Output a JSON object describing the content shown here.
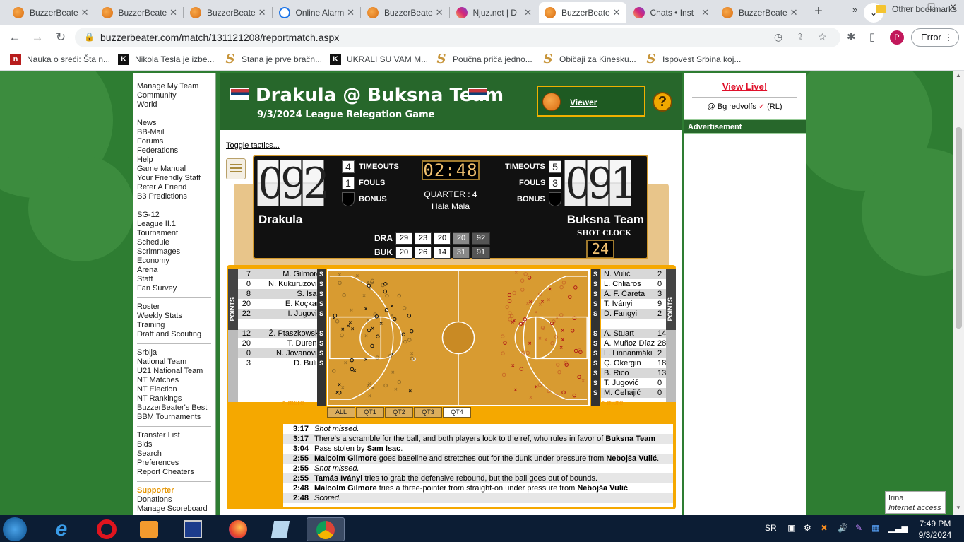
{
  "browser": {
    "tabs": [
      {
        "title": "BuzzerBeater",
        "icon": "basketball-icon",
        "active": false
      },
      {
        "title": "BuzzerBeater",
        "icon": "basketball-icon",
        "active": false
      },
      {
        "title": "BuzzerBeater",
        "icon": "basketball-icon",
        "active": false
      },
      {
        "title": "Online Alarm",
        "icon": "checkmark-icon",
        "active": false
      },
      {
        "title": "BuzzerBeater",
        "icon": "basketball-icon",
        "active": false
      },
      {
        "title": "Njuz.net | D",
        "icon": "instagram-icon",
        "active": false
      },
      {
        "title": "BuzzerBeater",
        "icon": "basketball-icon",
        "active": true
      },
      {
        "title": "Chats • Inst",
        "icon": "instagram-icon",
        "active": false
      },
      {
        "title": "BuzzerBeater",
        "icon": "basketball-icon",
        "active": false
      }
    ],
    "url": "buzzerbeater.com/match/131121208/reportmatch.aspx",
    "profile_initial": "P",
    "error_label": "Error",
    "bookmarks": [
      {
        "label": "Nauka o sreći: Šta n...",
        "icon": "n"
      },
      {
        "label": "Nikola Tesla je izbe...",
        "icon": "K"
      },
      {
        "label": "Stana je prve bračn...",
        "icon": "S"
      },
      {
        "label": "UKRALI SU VAM M...",
        "icon": "K"
      },
      {
        "label": "Poučna priča jedno...",
        "icon": "S"
      },
      {
        "label": "Običaji za Kinesku...",
        "icon": "S"
      },
      {
        "label": "Ispovest Srbina koj...",
        "icon": "S"
      }
    ],
    "bookmarks_more": "»",
    "other_bookmarks": "Other bookmarks"
  },
  "nav": {
    "group1": [
      "Manage My Team",
      "Community",
      "World"
    ],
    "group2": [
      "News",
      "BB-Mail",
      "Forums",
      "Federations",
      "Help",
      "Game Manual",
      "Your Friendly Staff",
      "Refer A Friend",
      "B3 Predictions"
    ],
    "group3": [
      "SG-12",
      "League II.1",
      "Tournament",
      "Schedule",
      "Scrimmages",
      "Economy",
      "Arena",
      "Staff",
      "Fan Survey"
    ],
    "group4": [
      "Roster",
      "Weekly Stats",
      "Training",
      "Draft and Scouting"
    ],
    "group5": [
      "Srbija",
      "National Team",
      "U21 National Team",
      "NT Matches",
      "NT Election",
      "NT Rankings",
      "BuzzerBeater's Best",
      "BBM Tournaments"
    ],
    "group6": [
      "Transfer List",
      "Bids",
      "Search",
      "Preferences",
      "Report Cheaters"
    ],
    "group7_title": "Supporter",
    "group7": [
      "Donations",
      "Manage Scoreboard"
    ]
  },
  "match": {
    "title": "Drakula @ Buksna Team",
    "subtitle": "9/3/2024 League Relegation Game",
    "viewer_label": "Viewer",
    "help": "?",
    "toggle_tactics": "Toggle tactics..."
  },
  "scoreboard": {
    "home": {
      "name": "Drakula",
      "score_digits": [
        "0",
        "9",
        "2"
      ],
      "timeouts": "4",
      "fouls": "1"
    },
    "away": {
      "name": "Buksna Team",
      "score_digits": [
        "0",
        "9",
        "1"
      ],
      "timeouts": "5",
      "fouls": "3"
    },
    "labels": {
      "timeouts": "TIMEOUTS",
      "fouls": "FOULS",
      "bonus": "BONUS",
      "shot_clock": "SHOT CLOCK"
    },
    "game_clock": "02:48",
    "quarter": "QUARTER : 4",
    "arena": "Hala Mala",
    "shot_clock": "24",
    "quarters": [
      {
        "tag": "DRA",
        "q": [
          "29",
          "23",
          "20",
          "20"
        ],
        "total": "92"
      },
      {
        "tag": "BUK",
        "q": [
          "20",
          "26",
          "14",
          "31"
        ],
        "total": "91"
      }
    ]
  },
  "rosters": {
    "points_label": "POINTS",
    "home_on": [
      {
        "name": "M. Gilmore",
        "pts": "7"
      },
      {
        "name": "N. Kukuruzović",
        "pts": "0"
      },
      {
        "name": "S. Isac",
        "pts": "8"
      },
      {
        "name": "E. Koçkan",
        "pts": "20"
      },
      {
        "name": "I. Jugović",
        "pts": "22"
      }
    ],
    "home_bench": [
      {
        "name": "Ž. Ptaszkowski",
        "pts": "12"
      },
      {
        "name": "T. Durens",
        "pts": "20"
      },
      {
        "name": "N. Jovanović",
        "pts": "0"
      },
      {
        "name": "D. Bulić",
        "pts": "3"
      }
    ],
    "away_on": [
      {
        "name": "N. Vulić",
        "pts": "2"
      },
      {
        "name": "L. Chliaros",
        "pts": "0"
      },
      {
        "name": "A. F. Careta",
        "pts": "3"
      },
      {
        "name": "T. Iványi",
        "pts": "9"
      },
      {
        "name": "D. Fangyi",
        "pts": "2"
      }
    ],
    "away_bench": [
      {
        "name": "A. Stuart",
        "pts": "14"
      },
      {
        "name": "A. Muñoz Díaz",
        "pts": "28"
      },
      {
        "name": "L. Linnanmäki",
        "pts": "2"
      },
      {
        "name": "Ç. Okergin",
        "pts": "18"
      },
      {
        "name": "B. Rico",
        "pts": "13"
      },
      {
        "name": "T. Jugović",
        "pts": "0"
      },
      {
        "name": "M. Cehajić",
        "pts": "0"
      }
    ],
    "starter_marker": "S",
    "more": "> more"
  },
  "quarter_tabs": [
    "ALL",
    "QT1",
    "QT2",
    "QT3",
    "QT4"
  ],
  "selected_quarter": "QT4",
  "pbp": [
    {
      "time": "3:17",
      "parts": [
        {
          "t": "Shot missed.",
          "i": true
        }
      ]
    },
    {
      "time": "3:17",
      "parts": [
        {
          "t": "There's a scramble for the ball, and both players look to the ref, who rules in favor of "
        },
        {
          "t": "Buksna Team",
          "b": true
        }
      ]
    },
    {
      "time": "3:04",
      "parts": [
        {
          "t": "Pass stolen by "
        },
        {
          "t": "Sam Isac",
          "b": true
        },
        {
          "t": "."
        }
      ]
    },
    {
      "time": "2:55",
      "parts": [
        {
          "t": "Malcolm Gilmore",
          "b": true
        },
        {
          "t": " goes baseline and stretches out for the dunk under pressure from "
        },
        {
          "t": "Nebojša Vulić",
          "b": true
        },
        {
          "t": "."
        }
      ]
    },
    {
      "time": "2:55",
      "parts": [
        {
          "t": "Shot missed.",
          "i": true
        }
      ]
    },
    {
      "time": "2:55",
      "parts": [
        {
          "t": "Tamás Iványi",
          "b": true
        },
        {
          "t": " tries to grab the defensive rebound, but the ball goes out of bounds."
        }
      ]
    },
    {
      "time": "2:48",
      "parts": [
        {
          "t": "Malcolm Gilmore",
          "b": true
        },
        {
          "t": " tries a three-pointer from straight-on under pressure from "
        },
        {
          "t": "Nebojša Vulić",
          "b": true
        },
        {
          "t": "."
        }
      ]
    },
    {
      "time": "2:48",
      "parts": [
        {
          "t": "Scored.",
          "i": true
        }
      ]
    }
  ],
  "right": {
    "view_live": "View Live!",
    "at": "@",
    "user": "Bg redvolfs",
    "check": "✓",
    "league_tag": "(RL)",
    "ad": "Advertisement"
  },
  "taskbar": {
    "lang": "SR",
    "time": "7:49 PM",
    "date": "9/3/2024",
    "net_name": "Irina",
    "net_status": "Internet access"
  },
  "colors": {
    "site_green": "#27672b",
    "accent_orange": "#f5a800",
    "home_marks": "#111111",
    "away_marks": "#b01818"
  }
}
